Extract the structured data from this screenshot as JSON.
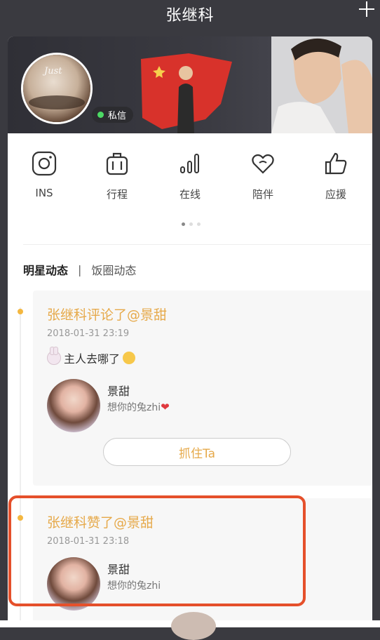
{
  "header": {
    "title": "张继科"
  },
  "profile": {
    "dm_label": "私信",
    "avatar_signature": "Just"
  },
  "quick_actions": [
    {
      "label": "INS",
      "icon": "instagram-icon"
    },
    {
      "label": "行程",
      "icon": "luggage-icon"
    },
    {
      "label": "在线",
      "icon": "signal-bars-icon"
    },
    {
      "label": "陪伴",
      "icon": "hearts-icon"
    },
    {
      "label": "应援",
      "icon": "thumbs-up-icon"
    }
  ],
  "tabs": {
    "active": "明星动态",
    "divider": "|",
    "other": "饭圈动态"
  },
  "feed": [
    {
      "title": "张继科评论了@景甜",
      "time": "2018-01-31 23:19",
      "text": "主人去哪了",
      "quote_name": "景甜",
      "quote_text": "想你的兔zhi",
      "button": "抓住Ta"
    },
    {
      "title": "张继科赞了@景甜",
      "time": "2018-01-31 23:18",
      "quote_name": "景甜",
      "quote_text": "想你的兔zhi"
    }
  ],
  "colors": {
    "accent": "#e6a94a",
    "highlight": "#e5502b",
    "online": "#4cd964"
  }
}
